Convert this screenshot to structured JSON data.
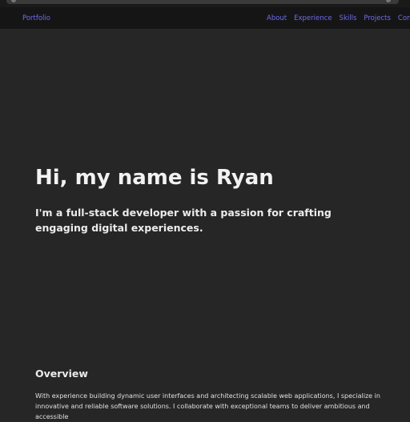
{
  "nav": {
    "brand": "Portfolio",
    "links": [
      "About",
      "Experience",
      "Skills",
      "Projects",
      "Contact"
    ]
  },
  "hero": {
    "title": "Hi, my name is Ryan",
    "subtitle": "I'm a full-stack developer with a passion for crafting engaging digital experiences."
  },
  "overview": {
    "heading": "Overview",
    "body": "With experience building dynamic user interfaces and architecting scalable web applications, I specialize in innovative and reliable software solutions. I collaborate with exceptional teams to deliver ambitious and accessible"
  },
  "colors": {
    "background": "#262626",
    "navbar": "#151515",
    "accent": "#6f6cf0",
    "text": "#ececec"
  }
}
